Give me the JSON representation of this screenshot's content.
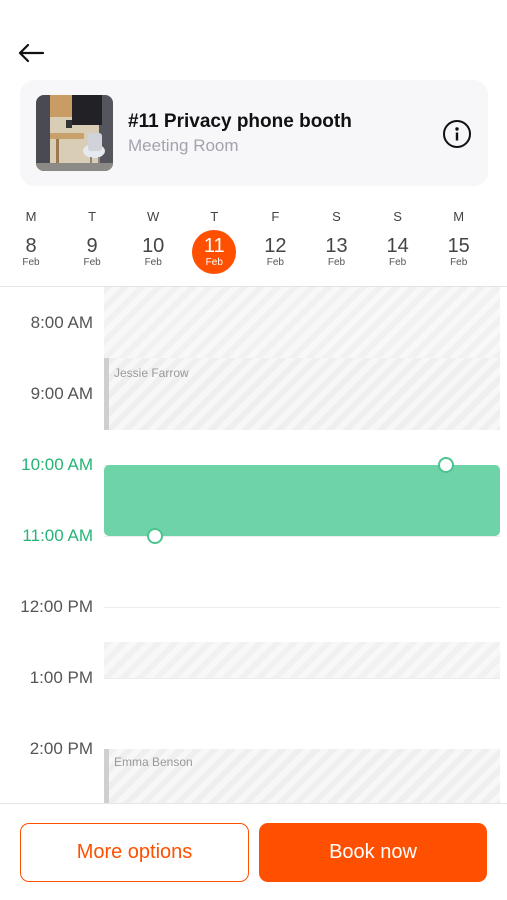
{
  "header": {
    "back_icon": "arrow-left-icon"
  },
  "room": {
    "title": "#11 Privacy phone booth",
    "subtitle": "Meeting Room",
    "thumbnail": "room-photo",
    "info_icon": "info-circle-icon"
  },
  "days": [
    {
      "dow": "M",
      "num": "8",
      "mon": "Feb",
      "selected": false
    },
    {
      "dow": "T",
      "num": "9",
      "mon": "Feb",
      "selected": false
    },
    {
      "dow": "W",
      "num": "10",
      "mon": "Feb",
      "selected": false
    },
    {
      "dow": "T",
      "num": "11",
      "mon": "Feb",
      "selected": true
    },
    {
      "dow": "F",
      "num": "12",
      "mon": "Feb",
      "selected": false
    },
    {
      "dow": "S",
      "num": "13",
      "mon": "Feb",
      "selected": false
    },
    {
      "dow": "S",
      "num": "14",
      "mon": "Feb",
      "selected": false
    },
    {
      "dow": "M",
      "num": "15",
      "mon": "Feb",
      "selected": false
    }
  ],
  "timeline": {
    "hours": [
      "8:00 AM",
      "9:00 AM",
      "10:00 AM",
      "11:00 AM",
      "12:00 PM",
      "1:00 PM",
      "2:00 PM"
    ],
    "bookings": [
      {
        "name": "Jessie Farrow"
      },
      {
        "name": "Emma Benson"
      }
    ]
  },
  "footer": {
    "more_options": "More options",
    "book_now": "Book now"
  },
  "colors": {
    "accent": "#fe5000",
    "selection": "#6ed4a8",
    "active_time": "#26b476"
  }
}
